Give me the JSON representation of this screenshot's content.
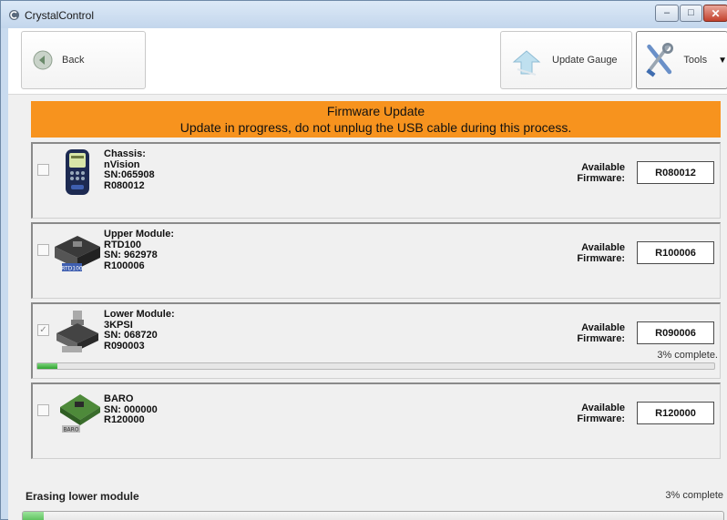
{
  "window": {
    "title": "CrystalControl"
  },
  "toolbar": {
    "back_label": "Back",
    "update_label": "Update Gauge",
    "tools_label": "Tools"
  },
  "banner": {
    "title": "Firmware Update",
    "message": "Update in progress, do not unplug the USB cable during this process."
  },
  "devices": [
    {
      "lines": [
        "Chassis:",
        "nVision",
        "SN:065908",
        "R080012"
      ],
      "available_label_1": "Available",
      "available_label_2": "Firmware:",
      "firmware": "R080012",
      "checked": false,
      "icon": "nvision-gauge-icon"
    },
    {
      "lines": [
        "Upper Module:",
        "RTD100",
        "SN: 962978",
        "R100006"
      ],
      "available_label_1": "Available",
      "available_label_2": "Firmware:",
      "firmware": "R100006",
      "checked": false,
      "icon": "rtd-module-icon",
      "icon_text": "RTD100"
    },
    {
      "lines": [
        "Lower Module:",
        "3KPSI",
        "SN: 068720",
        "R090003"
      ],
      "available_label_1": "Available",
      "available_label_2": "Firmware:",
      "firmware": "R090006",
      "checked": true,
      "progress_text": "3% complete.",
      "progress": 0.03,
      "icon": "pressure-module-icon"
    },
    {
      "lines": [
        "BARO",
        "SN: 000000",
        "R120000"
      ],
      "available_label_1": "Available",
      "available_label_2": "Firmware:",
      "firmware": "R120000",
      "checked": false,
      "icon": "baro-module-icon",
      "icon_text": "BARO"
    }
  ],
  "status": {
    "text": "Erasing lower module",
    "percent_text": "3% complete",
    "progress": 0.03
  },
  "colors": {
    "banner": "#f7931e",
    "progress": "#2ea52e",
    "window_frame": "#c9dbef"
  }
}
